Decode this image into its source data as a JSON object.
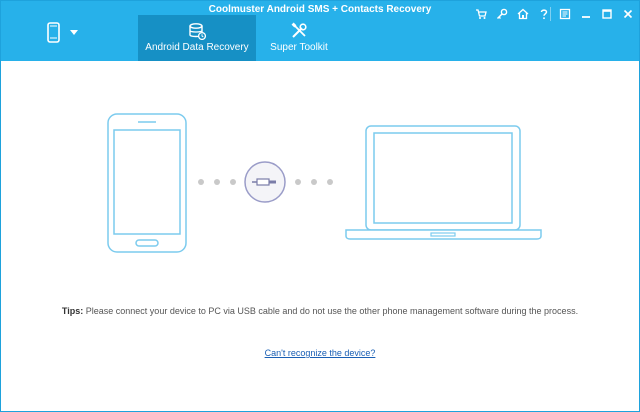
{
  "window": {
    "title": "Coolmuster Android SMS + Contacts Recovery"
  },
  "tabs": [
    {
      "label": "Android Data Recovery"
    },
    {
      "label": "Super Toolkit"
    }
  ],
  "tips": {
    "label": "Tips:",
    "text": "Please connect your device to PC via USB cable and do not use the other phone management software during the process."
  },
  "help_link": "Can't recognize the device?",
  "icons": [
    "phone-icon",
    "dropdown-arrow-icon",
    "database-icon",
    "tools-icon",
    "cart-icon",
    "key-icon",
    "home-icon",
    "help-icon",
    "feedback-icon",
    "minimize-icon",
    "maximize-icon",
    "close-icon",
    "usb-plug-icon"
  ],
  "colors": {
    "header": "#27b1ea",
    "active_tab": "#1690c5",
    "outline": "#7ccbee",
    "link": "#1a5fb4"
  }
}
